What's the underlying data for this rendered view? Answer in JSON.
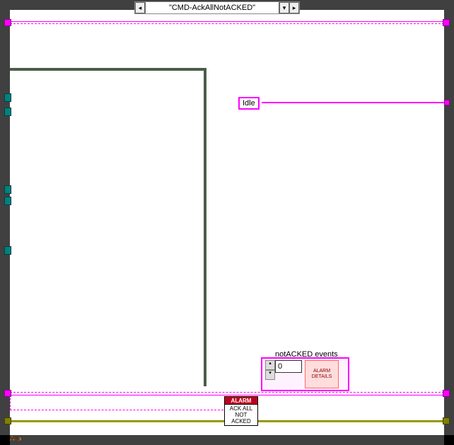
{
  "case_structure": {
    "selector_label": "\"CMD-AckAllNotACKED\""
  },
  "idle_const": {
    "text": "Idle"
  },
  "notacked": {
    "label": "notACKED events",
    "numeric_value": "0",
    "details_label": "ALARM\nDETAILS"
  },
  "alarm_node": {
    "header": "ALARM",
    "line1": "ACK ALL",
    "line2": "NOT",
    "line3": "ACKED"
  },
  "index_terminal": "A=a"
}
